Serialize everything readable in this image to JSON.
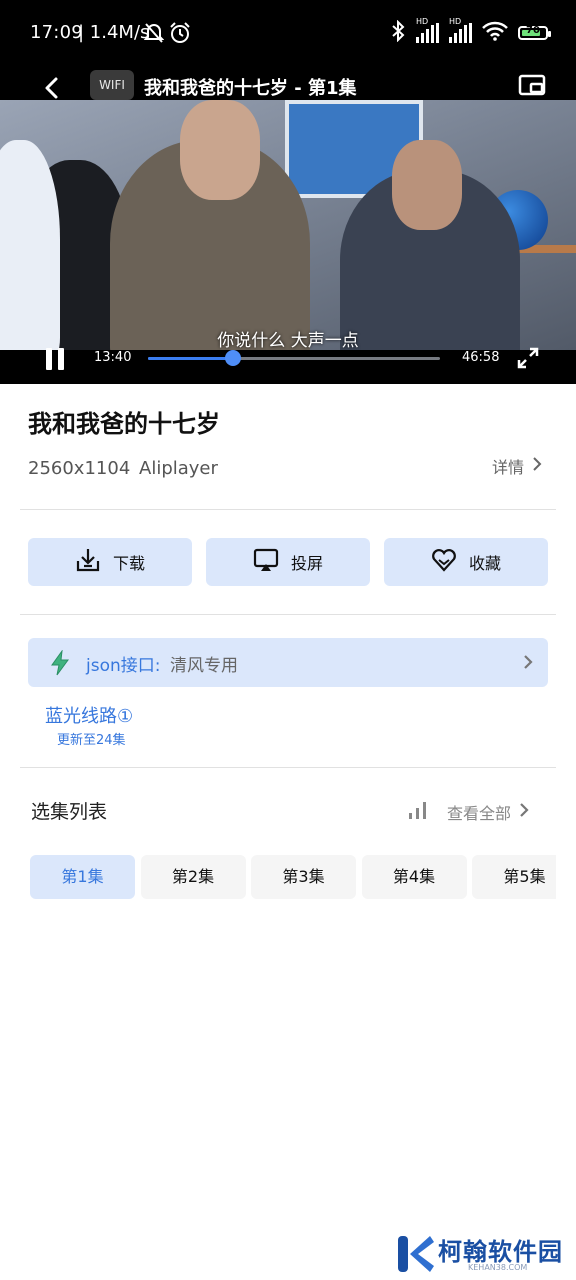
{
  "status_bar": {
    "time": "17:09",
    "network_speed": "| 1.4M/s",
    "hd1": "HD",
    "hd2": "HD",
    "battery_level": "70"
  },
  "player": {
    "wifi_badge": "WIFI",
    "title": "我和我爸的十七岁 - 第1集",
    "subtitle": "你说什么 大声一点",
    "current_time": "13:40",
    "total_time": "46:58",
    "progress_fraction": 0.291,
    "accent_color": "#3b7ef2"
  },
  "info": {
    "title": "我和我爸的十七岁",
    "resolution": "2560x1104",
    "player_name": "Aliplayer",
    "details_label": "详情"
  },
  "actions": {
    "download": "下载",
    "cast": "投屏",
    "favorite": "收藏"
  },
  "source": {
    "label": "json接口:",
    "value": "清风专用"
  },
  "line": {
    "name": "蓝光线路①",
    "update": "更新至24集"
  },
  "episodes_section": {
    "title": "选集列表",
    "view_all": "查看全部",
    "items": [
      "第1集",
      "第2集",
      "第3集",
      "第4集",
      "第5集"
    ],
    "selected_index": 0
  },
  "watermark": {
    "text": "柯翰软件园",
    "sub": "KEHAN38.COM"
  }
}
